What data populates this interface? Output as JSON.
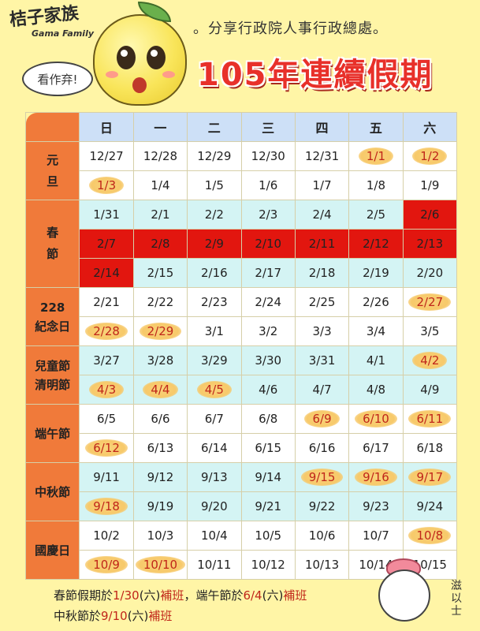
{
  "header": {
    "logo_text": "桔子家族",
    "logo_sub": "Gama Family",
    "bubble": "看作弃!",
    "subtitle": "。分享行政院人事行政總處。",
    "title": "105年連續假期"
  },
  "weekdays": [
    "日",
    "一",
    "二",
    "三",
    "四",
    "五",
    "六"
  ],
  "groups": [
    {
      "label": [
        "元",
        "旦"
      ],
      "rows": [
        [
          {
            "t": "12/27",
            "s": "w"
          },
          {
            "t": "12/28",
            "s": "w"
          },
          {
            "t": "12/29",
            "s": "w"
          },
          {
            "t": "12/30",
            "s": "w"
          },
          {
            "t": "12/31",
            "s": "w"
          },
          {
            "t": "1/1",
            "s": "w",
            "off": true
          },
          {
            "t": "1/2",
            "s": "w",
            "off": true
          }
        ],
        [
          {
            "t": "1/3",
            "s": "w",
            "off": true
          },
          {
            "t": "1/4",
            "s": "w"
          },
          {
            "t": "1/5",
            "s": "w"
          },
          {
            "t": "1/6",
            "s": "w"
          },
          {
            "t": "1/7",
            "s": "w"
          },
          {
            "t": "1/8",
            "s": "w"
          },
          {
            "t": "1/9",
            "s": "w"
          }
        ]
      ]
    },
    {
      "label": [
        "春",
        "節"
      ],
      "rows": [
        [
          {
            "t": "1/31",
            "s": "c"
          },
          {
            "t": "2/1",
            "s": "c"
          },
          {
            "t": "2/2",
            "s": "c"
          },
          {
            "t": "2/3",
            "s": "c"
          },
          {
            "t": "2/4",
            "s": "c"
          },
          {
            "t": "2/5",
            "s": "c"
          },
          {
            "t": "2/6",
            "s": "r"
          }
        ],
        [
          {
            "t": "2/7",
            "s": "r"
          },
          {
            "t": "2/8",
            "s": "r"
          },
          {
            "t": "2/9",
            "s": "r"
          },
          {
            "t": "2/10",
            "s": "r"
          },
          {
            "t": "2/11",
            "s": "r"
          },
          {
            "t": "2/12",
            "s": "r"
          },
          {
            "t": "2/13",
            "s": "r"
          }
        ],
        [
          {
            "t": "2/14",
            "s": "r"
          },
          {
            "t": "2/15",
            "s": "c"
          },
          {
            "t": "2/16",
            "s": "c"
          },
          {
            "t": "2/17",
            "s": "c"
          },
          {
            "t": "2/18",
            "s": "c"
          },
          {
            "t": "2/19",
            "s": "c"
          },
          {
            "t": "2/20",
            "s": "c"
          }
        ]
      ]
    },
    {
      "label": [
        "228",
        "紀念日"
      ],
      "rows": [
        [
          {
            "t": "2/21",
            "s": "w"
          },
          {
            "t": "2/22",
            "s": "w"
          },
          {
            "t": "2/23",
            "s": "w"
          },
          {
            "t": "2/24",
            "s": "w"
          },
          {
            "t": "2/25",
            "s": "w"
          },
          {
            "t": "2/26",
            "s": "w"
          },
          {
            "t": "2/27",
            "s": "w",
            "off": true
          }
        ],
        [
          {
            "t": "2/28",
            "s": "w",
            "off": true
          },
          {
            "t": "2/29",
            "s": "w",
            "off": true
          },
          {
            "t": "3/1",
            "s": "w"
          },
          {
            "t": "3/2",
            "s": "w"
          },
          {
            "t": "3/3",
            "s": "w"
          },
          {
            "t": "3/4",
            "s": "w"
          },
          {
            "t": "3/5",
            "s": "w"
          }
        ]
      ]
    },
    {
      "label": [
        "兒童節",
        "清明節"
      ],
      "rows": [
        [
          {
            "t": "3/27",
            "s": "c"
          },
          {
            "t": "3/28",
            "s": "c"
          },
          {
            "t": "3/29",
            "s": "c"
          },
          {
            "t": "3/30",
            "s": "c"
          },
          {
            "t": "3/31",
            "s": "c"
          },
          {
            "t": "4/1",
            "s": "c"
          },
          {
            "t": "4/2",
            "s": "c",
            "off": true
          }
        ],
        [
          {
            "t": "4/3",
            "s": "c",
            "off": true
          },
          {
            "t": "4/4",
            "s": "c",
            "off": true
          },
          {
            "t": "4/5",
            "s": "c",
            "off": true
          },
          {
            "t": "4/6",
            "s": "c"
          },
          {
            "t": "4/7",
            "s": "c"
          },
          {
            "t": "4/8",
            "s": "c"
          },
          {
            "t": "4/9",
            "s": "c"
          }
        ]
      ]
    },
    {
      "label": [
        "端午節"
      ],
      "rows": [
        [
          {
            "t": "6/5",
            "s": "w"
          },
          {
            "t": "6/6",
            "s": "w"
          },
          {
            "t": "6/7",
            "s": "w"
          },
          {
            "t": "6/8",
            "s": "w"
          },
          {
            "t": "6/9",
            "s": "w",
            "off": true
          },
          {
            "t": "6/10",
            "s": "w",
            "off": true
          },
          {
            "t": "6/11",
            "s": "w",
            "off": true
          }
        ],
        [
          {
            "t": "6/12",
            "s": "w",
            "off": true
          },
          {
            "t": "6/13",
            "s": "w"
          },
          {
            "t": "6/14",
            "s": "w"
          },
          {
            "t": "6/15",
            "s": "w"
          },
          {
            "t": "6/16",
            "s": "w"
          },
          {
            "t": "6/17",
            "s": "w"
          },
          {
            "t": "6/18",
            "s": "w"
          }
        ]
      ]
    },
    {
      "label": [
        "中秋節"
      ],
      "rows": [
        [
          {
            "t": "9/11",
            "s": "c"
          },
          {
            "t": "9/12",
            "s": "c"
          },
          {
            "t": "9/13",
            "s": "c"
          },
          {
            "t": "9/14",
            "s": "c"
          },
          {
            "t": "9/15",
            "s": "c",
            "off": true
          },
          {
            "t": "9/16",
            "s": "c",
            "off": true
          },
          {
            "t": "9/17",
            "s": "c",
            "off": true
          }
        ],
        [
          {
            "t": "9/18",
            "s": "c",
            "off": true
          },
          {
            "t": "9/19",
            "s": "c"
          },
          {
            "t": "9/20",
            "s": "c"
          },
          {
            "t": "9/21",
            "s": "c"
          },
          {
            "t": "9/22",
            "s": "c"
          },
          {
            "t": "9/23",
            "s": "c"
          },
          {
            "t": "9/24",
            "s": "c"
          }
        ]
      ]
    },
    {
      "label": [
        "國慶日"
      ],
      "rows": [
        [
          {
            "t": "10/2",
            "s": "w"
          },
          {
            "t": "10/3",
            "s": "w"
          },
          {
            "t": "10/4",
            "s": "w"
          },
          {
            "t": "10/5",
            "s": "w"
          },
          {
            "t": "10/6",
            "s": "w"
          },
          {
            "t": "10/7",
            "s": "w"
          },
          {
            "t": "10/8",
            "s": "w",
            "off": true
          }
        ],
        [
          {
            "t": "10/9",
            "s": "w",
            "off": true
          },
          {
            "t": "10/10",
            "s": "w",
            "off": true
          },
          {
            "t": "10/11",
            "s": "w"
          },
          {
            "t": "10/12",
            "s": "w"
          },
          {
            "t": "10/13",
            "s": "w"
          },
          {
            "t": "10/14",
            "s": "w"
          },
          {
            "t": "10/15",
            "s": "w"
          }
        ]
      ]
    }
  ],
  "footer": {
    "line1": [
      {
        "t": "春節假期於",
        "hl": false
      },
      {
        "t": "1/30",
        "hl": true
      },
      {
        "t": "(六)",
        "hl": false
      },
      {
        "t": "補班",
        "hl": true
      },
      {
        "t": "，端午節於",
        "hl": false
      },
      {
        "t": "6/4",
        "hl": true
      },
      {
        "t": "(六)",
        "hl": false
      },
      {
        "t": "補班",
        "hl": true
      }
    ],
    "line2": [
      {
        "t": "中秋節於",
        "hl": false
      },
      {
        "t": "9/10",
        "hl": true
      },
      {
        "t": "(六)",
        "hl": false
      },
      {
        "t": "補班",
        "hl": true
      }
    ]
  },
  "sticker_text": "滋以士",
  "colors": {
    "background": "#fff5a6",
    "header_orange": "#f07a3a",
    "holiday_red": "#e2160f",
    "cyan_row": "#d4f4f4",
    "title_red": "#e8302a"
  }
}
